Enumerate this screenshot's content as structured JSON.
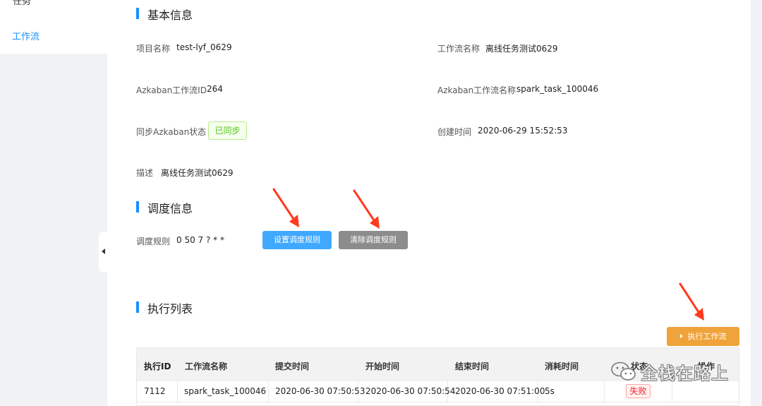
{
  "sidebar": {
    "cut_item_label": "任务",
    "active_item_label": "工作流"
  },
  "basic_info": {
    "title": "基本信息",
    "project_name_label": "项目名称",
    "project_name_value": "test-lyf_0629",
    "workflow_name_label": "工作流名称",
    "workflow_name_value": "离线任务测试0629",
    "azkaban_id_label": "Azkaban工作流ID",
    "azkaban_id_value": "264",
    "azkaban_name_label": "Azkaban工作流名称",
    "azkaban_name_value": "spark_task_100046",
    "sync_status_label": "同步Azkaban状态",
    "sync_status_value": "已同步",
    "created_time_label": "创建时间",
    "created_time_value": "2020-06-29 15:52:53",
    "description_label": "描述",
    "description_value": "离线任务测试0629"
  },
  "schedule_info": {
    "title": "调度信息",
    "rule_label": "调度规则",
    "rule_value": "0 50 7 ? * *",
    "set_rule_button": "设置调度规则",
    "clear_rule_button": "清除调度规则"
  },
  "execution_list": {
    "title": "执行列表",
    "run_button": "执行工作流",
    "columns": [
      "执行ID",
      "工作流名称",
      "提交时间",
      "开始时间",
      "结束时间",
      "消耗时间",
      "状态",
      "操作"
    ],
    "rows": [
      {
        "id": "7112",
        "workflow_name": "spark_task_100046",
        "submit_time": "2020-06-30 07:50:53",
        "start_time": "2020-06-30 07:50:54",
        "end_time": "2020-06-30 07:51:00",
        "duration": "5s",
        "status": "失败"
      }
    ]
  },
  "watermark": {
    "text": "全栈在路上"
  },
  "colors": {
    "primary": "#1890ff",
    "set_button": "#40a9ff",
    "clear_button": "#8c8c8c",
    "run_button": "#f0a33b",
    "arrow": "#ff3b1f",
    "success": "#52c41a",
    "fail": "#f5222d"
  }
}
